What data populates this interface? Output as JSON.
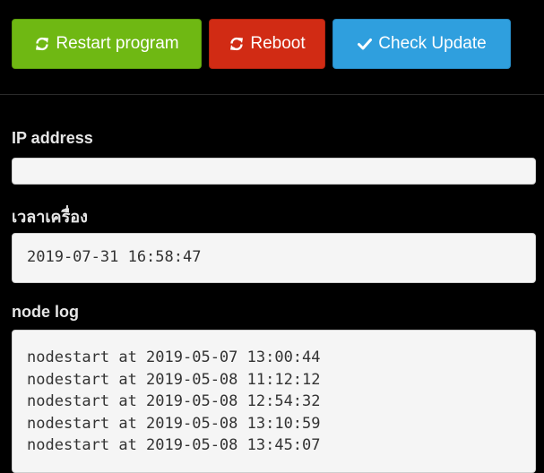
{
  "toolbar": {
    "restart_label": "Restart program",
    "reboot_label": "Reboot",
    "update_label": "Check Update",
    "restart_icon": "refresh-icon",
    "reboot_icon": "refresh-icon",
    "update_icon": "checkmark-icon",
    "colors": {
      "restart": "#6fb813",
      "reboot": "#d12b14",
      "update": "#2f9fde"
    }
  },
  "ip": {
    "label": "IP address",
    "value": ""
  },
  "machine_time": {
    "label": "เวลาเครื่อง",
    "value": "2019-07-31 16:58:47"
  },
  "node_log": {
    "label": "node log",
    "lines": [
      "nodestart at 2019-05-07 13:00:44",
      "nodestart at 2019-05-08 11:12:12",
      "nodestart at 2019-05-08 12:54:32",
      "nodestart at 2019-05-08 13:10:59",
      "nodestart at 2019-05-08 13:45:07"
    ]
  }
}
